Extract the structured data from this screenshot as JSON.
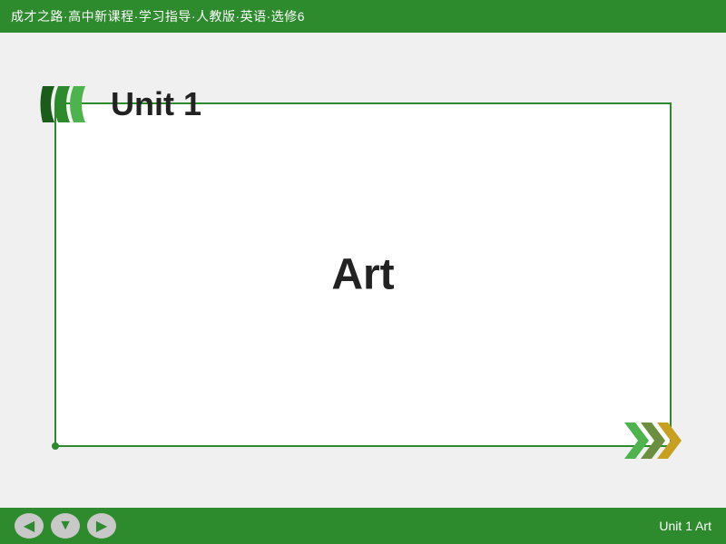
{
  "header": {
    "title": "成才之路·高中新课程·学习指导·人教版·英语·选修6"
  },
  "card": {
    "unit_label": "Unit 1",
    "topic_label": "Art"
  },
  "footer": {
    "status_label": "Unit 1   Art",
    "nav": {
      "back_label": "◀",
      "down_label": "▼",
      "forward_label": "▶"
    }
  },
  "colors": {
    "green": "#2d8a2d",
    "dark_green": "#1a5c1a",
    "light_green": "#4db34d",
    "olive": "#6b8f3e"
  }
}
